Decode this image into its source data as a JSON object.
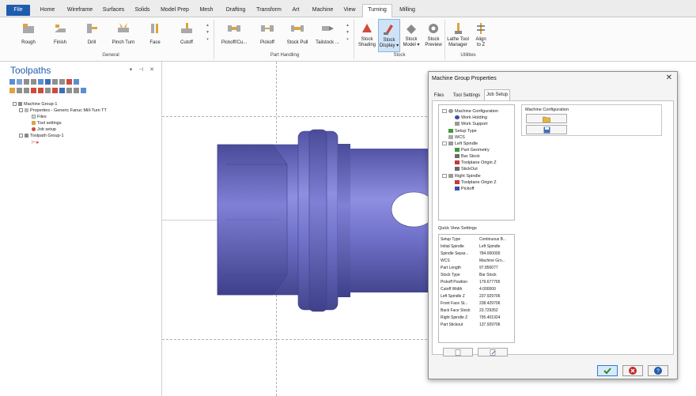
{
  "ribbon_tabs": [
    "File",
    "Home",
    "Wireframe",
    "Surfaces",
    "Solids",
    "Model Prep",
    "Mesh",
    "Drafting",
    "Transform",
    "Art",
    "Machine",
    "View",
    "Turning",
    "Milling"
  ],
  "active_tab": "Turning",
  "ribbon_buttons": [
    "Rough",
    "Finish",
    "Drill",
    "Pinch Turn",
    "Face",
    "Cutoff",
    "Pickoff/Cu...",
    "Pickoff",
    "Stock Pull",
    "Tailstock ...",
    "Stock Shading",
    "Stock Display",
    "Stock Model",
    "Stock Preview",
    "Lathe Tool Manager",
    "Align to Z"
  ],
  "ribbon_groups": [
    "General",
    "Part Handling",
    "Stock",
    "Utilities"
  ],
  "panel": {
    "title": "Toolpaths",
    "controls": "▾ ⊣ ✕",
    "tree": [
      "Machine Group-1",
      "Properties - Generic Fanuc Mill-Turn TT",
      "Files",
      "Tool settings",
      "Job setup",
      "Toolpath Group-1"
    ]
  },
  "dialog": {
    "title": "Machine Group Properties",
    "close": "✕",
    "tabs": [
      "Files",
      "Tool Settings",
      "Job Setup"
    ],
    "active_tab": "Job Setup",
    "tree": [
      "Machine Configuration",
      "Work Holding",
      "Work Support",
      "Setup Type",
      "WCS",
      "Left Spindle",
      "Part Geometry",
      "Bar Stock",
      "Toolplane Origin Z",
      "StickOut",
      "Right Spindle",
      "Toolplane Origin Z",
      "Pickoff"
    ],
    "config_label": "Machine Configuration",
    "quick_view_label": "Quick View Settings",
    "quick_view": [
      {
        "k": "Setup Type",
        "v": "Continuous B..."
      },
      {
        "k": "Initial Spindle",
        "v": "Left Spindle"
      },
      {
        "k": "Spindle Separ...",
        "v": "784.000000"
      },
      {
        "k": "WCS",
        "v": "Machine Gro..."
      },
      {
        "k": "Part Length",
        "v": "97.850077"
      },
      {
        "k": "Stock Type",
        "v": "Bar Stock"
      },
      {
        "k": "Pickoff Position",
        "v": "179.677765"
      },
      {
        "k": "Cutoff Width",
        "v": "4.000000"
      },
      {
        "k": "Left Spindle Z",
        "v": "237.929706"
      },
      {
        "k": "Front Face St...",
        "v": "238.429706"
      },
      {
        "k": "Back Face Stock",
        "v": "23.729352"
      },
      {
        "k": "Right Spindle Z",
        "v": "795.401924"
      },
      {
        "k": "Part Stickout",
        "v": "137.929706"
      }
    ]
  },
  "colors": {
    "accent": "#1f5cae",
    "part": "#6e6fc9",
    "part_dark": "#4d4e9e",
    "part_light": "#8f90e0",
    "ok": "#2b8a2b",
    "cancel": "#c62828",
    "help": "#1f5cae"
  },
  "icons": {
    "open": "folder-open-icon",
    "save": "save-icon",
    "ok": "checkmark-icon",
    "cancel": "cancel-icon",
    "help": "help-icon"
  }
}
